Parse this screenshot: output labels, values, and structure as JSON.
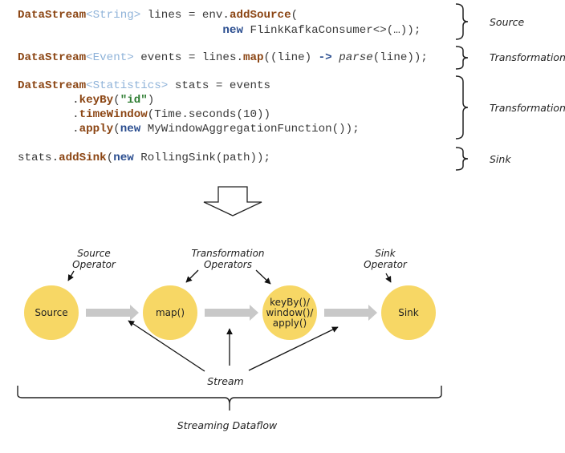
{
  "code": {
    "line1": {
      "type": "DataStream",
      "generic": "<String>",
      "rest": " lines = env.",
      "method": "addSource",
      "tail": "("
    },
    "line2": {
      "indent": "                              ",
      "new": "new",
      "rest": " FlinkKafkaConsumer<>(…));"
    },
    "line3": {
      "type": "DataStream",
      "generic": "<Event>",
      "rest": " events = lines.",
      "method": "map",
      "mid": "((line) ",
      "arrow": "->",
      "space": " ",
      "parse": "parse",
      "tail": "(line));"
    },
    "line4": {
      "type": "DataStream",
      "generic": "<Statistics>",
      "rest": " stats = events"
    },
    "line5": {
      "indent": "        .",
      "method": "keyBy",
      "open": "(",
      "str": "\"id\"",
      "close": ")"
    },
    "line6": {
      "indent": "        .",
      "method": "timeWindow",
      "rest": "(Time.seconds(10))"
    },
    "line7": {
      "indent": "        .",
      "method": "apply",
      "open": "(",
      "new": "new",
      "rest": " MyWindowAggregationFunction());"
    },
    "line8": {
      "start": "stats.",
      "method": "addSink",
      "open": "(",
      "new": "new",
      "rest": " RollingSink(path));"
    }
  },
  "brace_labels": [
    "Source",
    "Transformation",
    "Transformation",
    "Sink"
  ],
  "diagram": {
    "operators": [
      {
        "label": [
          "Source"
        ]
      },
      {
        "label": [
          "map()"
        ]
      },
      {
        "label": [
          "keyBy()/",
          "window()/",
          "apply()"
        ]
      },
      {
        "label": [
          "Sink"
        ]
      }
    ],
    "annotations": {
      "source_operator": [
        "Source",
        "Operator"
      ],
      "transformation_operators": [
        "Transformation",
        "Operators"
      ],
      "sink_operator": [
        "Sink",
        "Operator"
      ]
    },
    "stream_label": "Stream",
    "dataflow_label": "Streaming Dataflow"
  },
  "colors": {
    "operator_fill": "#f7d765",
    "stream_arrow": "#c8c8c8"
  }
}
